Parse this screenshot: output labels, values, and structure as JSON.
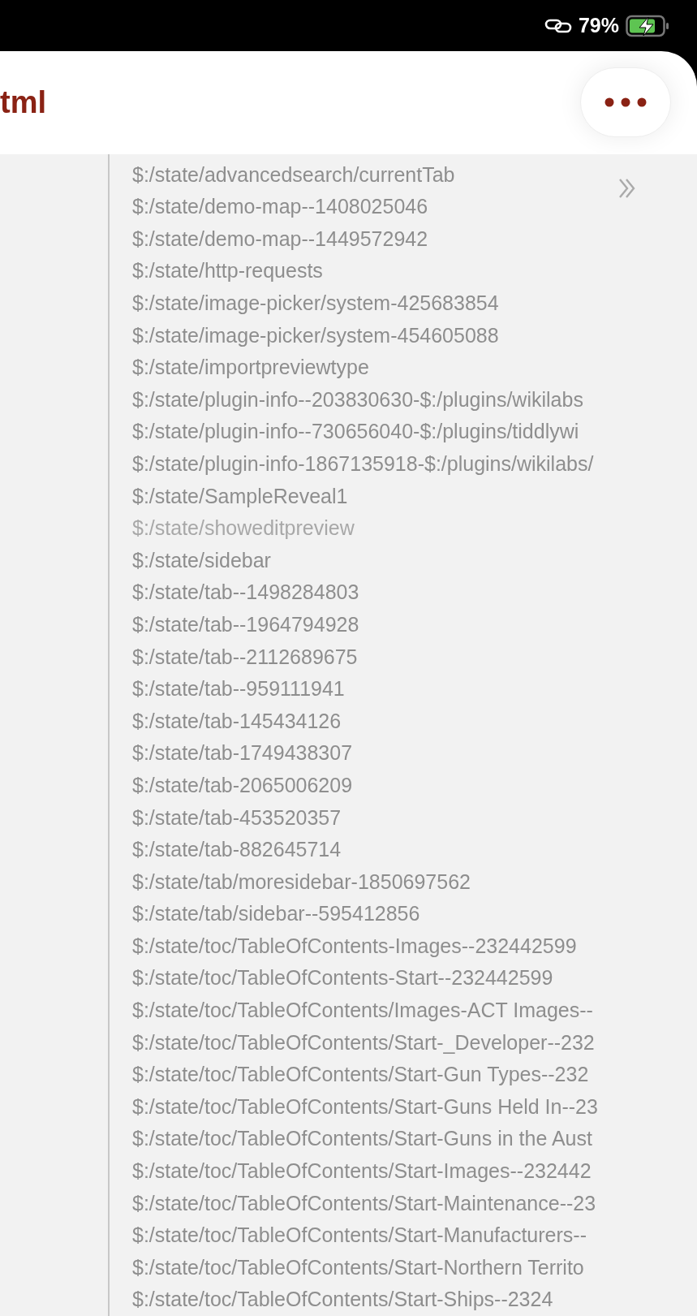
{
  "status_bar": {
    "battery": "79%"
  },
  "header": {
    "title": "tml"
  },
  "list": [
    {
      "text": "$:/state/advancedsearch/currentTab",
      "muted": false
    },
    {
      "text": "$:/state/demo-map--1408025046",
      "muted": false
    },
    {
      "text": "$:/state/demo-map--1449572942",
      "muted": false
    },
    {
      "text": "$:/state/http-requests",
      "muted": false
    },
    {
      "text": "$:/state/image-picker/system-425683854",
      "muted": false
    },
    {
      "text": "$:/state/image-picker/system-454605088",
      "muted": false
    },
    {
      "text": "$:/state/importpreviewtype",
      "muted": false
    },
    {
      "text": "$:/state/plugin-info--203830630-$:/plugins/wikilabs",
      "muted": false
    },
    {
      "text": "$:/state/plugin-info--730656040-$:/plugins/tiddlywi",
      "muted": false
    },
    {
      "text": "$:/state/plugin-info-1867135918-$:/plugins/wikilabs/",
      "muted": false
    },
    {
      "text": "$:/state/SampleReveal1",
      "muted": false
    },
    {
      "text": "$:/state/showeditpreview",
      "muted": true
    },
    {
      "text": "$:/state/sidebar",
      "muted": false
    },
    {
      "text": "$:/state/tab--1498284803",
      "muted": false
    },
    {
      "text": "$:/state/tab--1964794928",
      "muted": false
    },
    {
      "text": "$:/state/tab--2112689675",
      "muted": false
    },
    {
      "text": "$:/state/tab--959111941",
      "muted": false
    },
    {
      "text": "$:/state/tab-145434126",
      "muted": false
    },
    {
      "text": "$:/state/tab-1749438307",
      "muted": false
    },
    {
      "text": "$:/state/tab-2065006209",
      "muted": false
    },
    {
      "text": "$:/state/tab-453520357",
      "muted": false
    },
    {
      "text": "$:/state/tab-882645714",
      "muted": false
    },
    {
      "text": "$:/state/tab/moresidebar-1850697562",
      "muted": false
    },
    {
      "text": "$:/state/tab/sidebar--595412856",
      "muted": false
    },
    {
      "text": "$:/state/toc/TableOfContents-Images--232442599",
      "muted": false
    },
    {
      "text": "$:/state/toc/TableOfContents-Start--232442599",
      "muted": false
    },
    {
      "text": "$:/state/toc/TableOfContents/Images-ACT Images--",
      "muted": false
    },
    {
      "text": "$:/state/toc/TableOfContents/Start-_Developer--232",
      "muted": false
    },
    {
      "text": "$:/state/toc/TableOfContents/Start-Gun Types--232",
      "muted": false
    },
    {
      "text": "$:/state/toc/TableOfContents/Start-Guns Held In--23",
      "muted": false
    },
    {
      "text": "$:/state/toc/TableOfContents/Start-Guns in the Aust",
      "muted": false
    },
    {
      "text": "$:/state/toc/TableOfContents/Start-Images--232442",
      "muted": false
    },
    {
      "text": "$:/state/toc/TableOfContents/Start-Maintenance--23",
      "muted": false
    },
    {
      "text": "$:/state/toc/TableOfContents/Start-Manufacturers--",
      "muted": false
    },
    {
      "text": "$:/state/toc/TableOfContents/Start-Northern Territo",
      "muted": false
    },
    {
      "text": "$:/state/toc/TableOfContents/Start-Ships--2324",
      "muted": false
    }
  ]
}
